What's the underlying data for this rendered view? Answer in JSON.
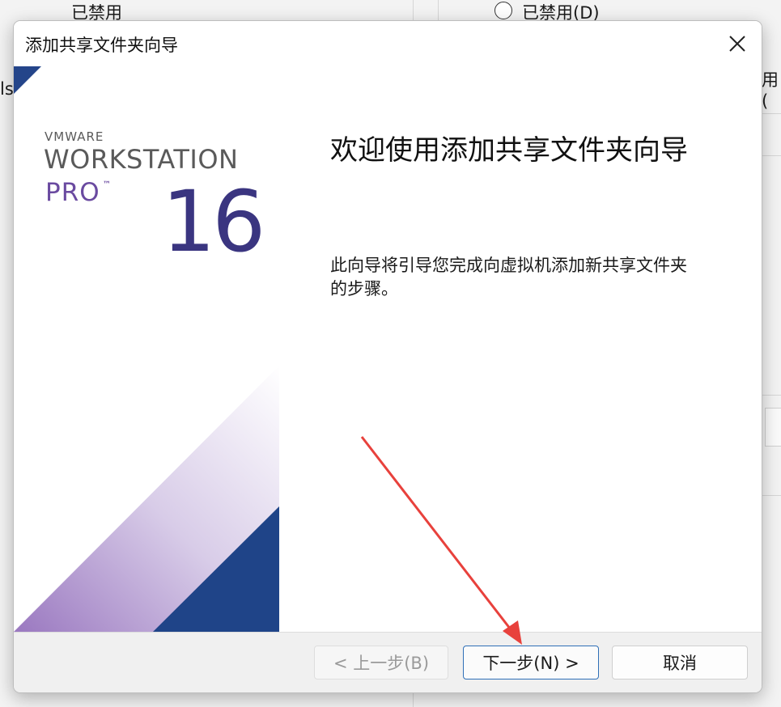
{
  "background": {
    "disabled_label_left": "已禁用",
    "disabled_radio_label": "已禁用(D)",
    "partial_left_text": "ls",
    "partial_right_text": "用("
  },
  "dialog": {
    "title": "添加共享文件夹向导",
    "close_label": "✕",
    "side": {
      "brand": "VMWARE",
      "product": "WORKSTATION",
      "edition": "PRO",
      "trademark": "™",
      "version": "16"
    },
    "heading": "欢迎使用添加共享文件夹向导",
    "description": "此向导将引导您完成向虚拟机添加新共享文件夹的步骤。",
    "buttons": {
      "back": "< 上一步(B)",
      "next": "下一步(N) >",
      "cancel": "取消"
    }
  },
  "colors": {
    "accent_blue": "#2f6fb7",
    "brand_navy": "#1f3f82",
    "brand_purple": "#6a4aa0",
    "annotation_red": "#e8413c"
  }
}
